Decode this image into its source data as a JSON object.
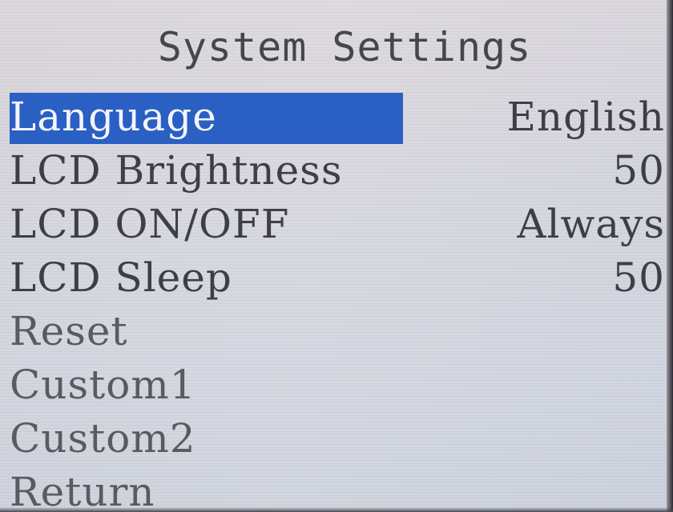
{
  "title": "System Settings",
  "menu": {
    "items": [
      {
        "label": "Language",
        "value": "English",
        "selected": true
      },
      {
        "label": "LCD Brightness",
        "value": "50"
      },
      {
        "label": "LCD ON/OFF",
        "value": "Always"
      },
      {
        "label": "LCD Sleep",
        "value": "50"
      },
      {
        "label": "Reset",
        "value": ""
      },
      {
        "label": "Custom1",
        "value": ""
      },
      {
        "label": "Custom2",
        "value": ""
      },
      {
        "label": "Return",
        "value": ""
      }
    ]
  },
  "colors": {
    "selection": "#2a5fc4",
    "text": "#3e3e46",
    "screen_background": "#d7d6dd"
  }
}
